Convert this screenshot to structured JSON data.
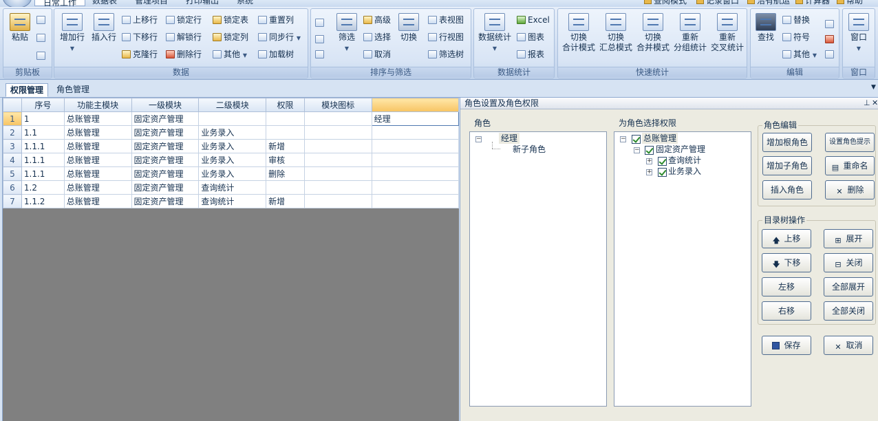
{
  "menu": {
    "tabs": [
      "日常工作",
      "数据表",
      "管理项目",
      "打印输出",
      "系统"
    ],
    "quick": [
      "查阅模式",
      "记录窗口",
      "沿有航运",
      "计算器",
      "帮助"
    ]
  },
  "ribbon": {
    "clipboard": {
      "label": "剪贴板",
      "paste": "粘贴"
    },
    "data": {
      "label": "数据",
      "add_row": "增加行",
      "insert_row": "插入行",
      "up_row": "上移行",
      "down_row": "下移行",
      "clone_row": "克隆行",
      "lock_row": "锁定行",
      "unlock_row": "解锁行",
      "delete_row": "删除行",
      "lock_table": "锁定表",
      "lock_col": "锁定列",
      "other": "其他",
      "reset_col": "重置列",
      "sync_row": "同步行",
      "load_tree": "加载树"
    },
    "sort": {
      "label": "排序与筛选",
      "filter": "筛选",
      "advanced": "高级",
      "select": "选择",
      "cancel": "取消",
      "switch": "切换",
      "table_view": "表视图",
      "row_view": "行视图",
      "filter_tree": "筛选树"
    },
    "stats": {
      "label": "数据统计",
      "data_stats": "数据统计",
      "excel": "Excel",
      "chart": "图表",
      "report": "报表"
    },
    "quick": {
      "label": "快速统计",
      "b1_1": "切换",
      "b1_2": "合计模式",
      "b2_1": "切换",
      "b2_2": "汇总模式",
      "b3_1": "切换",
      "b3_2": "合并模式",
      "b4_1": "重新",
      "b4_2": "分组统计",
      "b5_1": "重新",
      "b5_2": "交叉统计"
    },
    "edit": {
      "label": "编辑",
      "find": "查找",
      "replace": "替换",
      "symbol": "符号",
      "other": "其他"
    },
    "window": {
      "label": "窗口",
      "window": "窗口"
    }
  },
  "doc_tabs": [
    "权限管理",
    "角色管理"
  ],
  "grid": {
    "columns": [
      "序号",
      "功能主模块",
      "一级模块",
      "二级模块",
      "权限",
      "模块图标"
    ],
    "rows": [
      {
        "n": "1",
        "seq": "1",
        "main": "总账管理",
        "l1": "固定资产管理",
        "l2": "",
        "perm": "",
        "icon": "",
        "extra": "经理"
      },
      {
        "n": "2",
        "seq": "1.1",
        "main": "总账管理",
        "l1": "固定资产管理",
        "l2": "业务录入",
        "perm": "",
        "icon": "",
        "extra": ""
      },
      {
        "n": "3",
        "seq": "1.1.1",
        "main": "总账管理",
        "l1": "固定资产管理",
        "l2": "业务录入",
        "perm": "新增",
        "icon": "",
        "extra": ""
      },
      {
        "n": "4",
        "seq": "1.1.1",
        "main": "总账管理",
        "l1": "固定资产管理",
        "l2": "业务录入",
        "perm": "审核",
        "icon": "",
        "extra": ""
      },
      {
        "n": "5",
        "seq": "1.1.1",
        "main": "总账管理",
        "l1": "固定资产管理",
        "l2": "业务录入",
        "perm": "删除",
        "icon": "",
        "extra": ""
      },
      {
        "n": "6",
        "seq": "1.2",
        "main": "总账管理",
        "l1": "固定资产管理",
        "l2": "查询统计",
        "perm": "",
        "icon": "",
        "extra": ""
      },
      {
        "n": "7",
        "seq": "1.1.2",
        "main": "总账管理",
        "l1": "固定资产管理",
        "l2": "查询统计",
        "perm": "新增",
        "icon": "",
        "extra": ""
      }
    ]
  },
  "panel": {
    "title": "角色设置及角色权限",
    "role_label": "角色",
    "perm_label": "为角色选择权限",
    "roles": {
      "root": "经理",
      "child": "新子角色"
    },
    "perm_tree": {
      "root": "总账管理",
      "l1": "固定资产管理",
      "c1": "查询统计",
      "c2": "业务录入"
    },
    "role_edit": {
      "legend": "角色编辑",
      "add_root": "增加根角色",
      "set_hint": "设置角色提示",
      "add_child": "增加子角色",
      "rename": "重命名",
      "insert": "插入角色",
      "delete": "删除"
    },
    "tree_ops": {
      "legend": "目录树操作",
      "up": "上移",
      "expand": "展开",
      "down": "下移",
      "close": "关闭",
      "left": "左移",
      "expand_all": "全部展开",
      "right": "右移",
      "close_all": "全部关闭"
    },
    "save": "保存",
    "cancel": "取消"
  }
}
